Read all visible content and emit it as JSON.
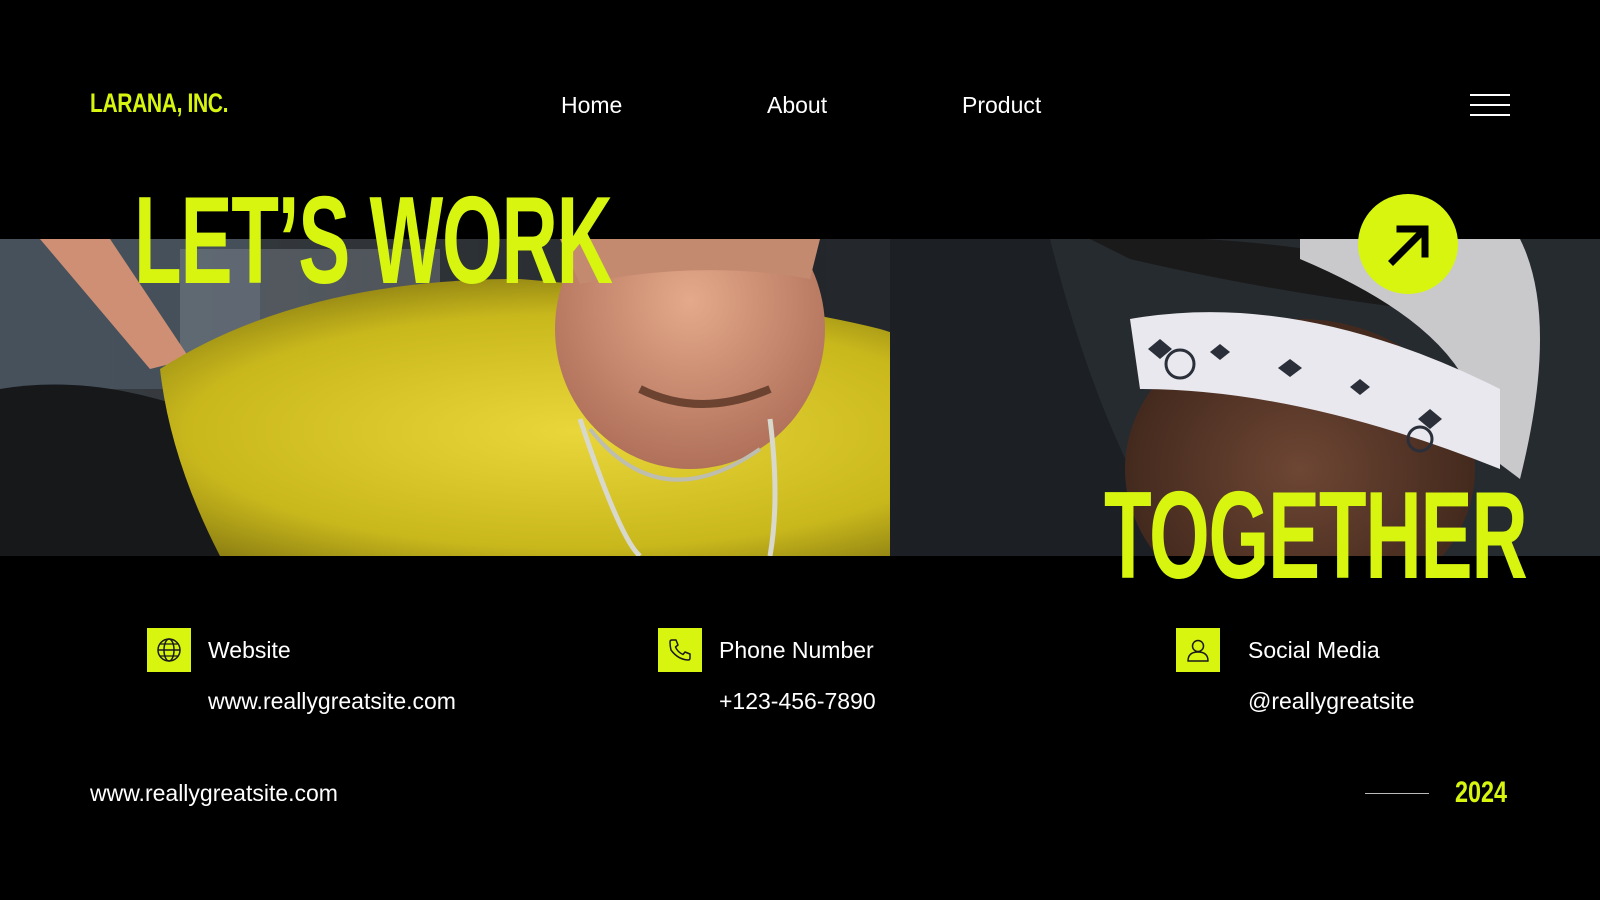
{
  "brand": {
    "name": "LARANA, INC."
  },
  "nav": {
    "items": [
      "Home",
      "About",
      "Product"
    ],
    "menu_icon": "hamburger-menu-icon"
  },
  "hero": {
    "headline_top": "LET’S WORK",
    "headline_bottom": "TOGETHER",
    "arrow_icon": "arrow-up-right-icon"
  },
  "contacts": [
    {
      "icon": "globe-icon",
      "label": "Website",
      "value": "www.reallygreatsite.com"
    },
    {
      "icon": "phone-icon",
      "label": "Phone Number",
      "value": "+123-456-7890"
    },
    {
      "icon": "user-icon",
      "label": "Social Media",
      "value": "@reallygreatsite"
    }
  ],
  "footer": {
    "url": "www.reallygreatsite.com",
    "year": "2024"
  },
  "colors": {
    "accent": "#d7f50f",
    "background": "#000000",
    "text": "#ffffff"
  }
}
